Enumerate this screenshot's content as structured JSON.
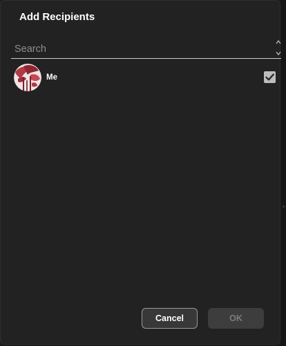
{
  "dialog": {
    "title": "Add Recipients"
  },
  "search": {
    "placeholder": "Search",
    "value": ""
  },
  "recipients": [
    {
      "name": "Me",
      "checked": true,
      "avatar_icon": "rose-avatar"
    }
  ],
  "buttons": {
    "cancel_label": "Cancel",
    "ok_label": "OK",
    "ok_enabled": false
  },
  "colors": {
    "background": "#222222",
    "button_border": "#9a9a9a",
    "checkbox": "#bdbdbd",
    "avatar_accent": "#b13a46"
  }
}
